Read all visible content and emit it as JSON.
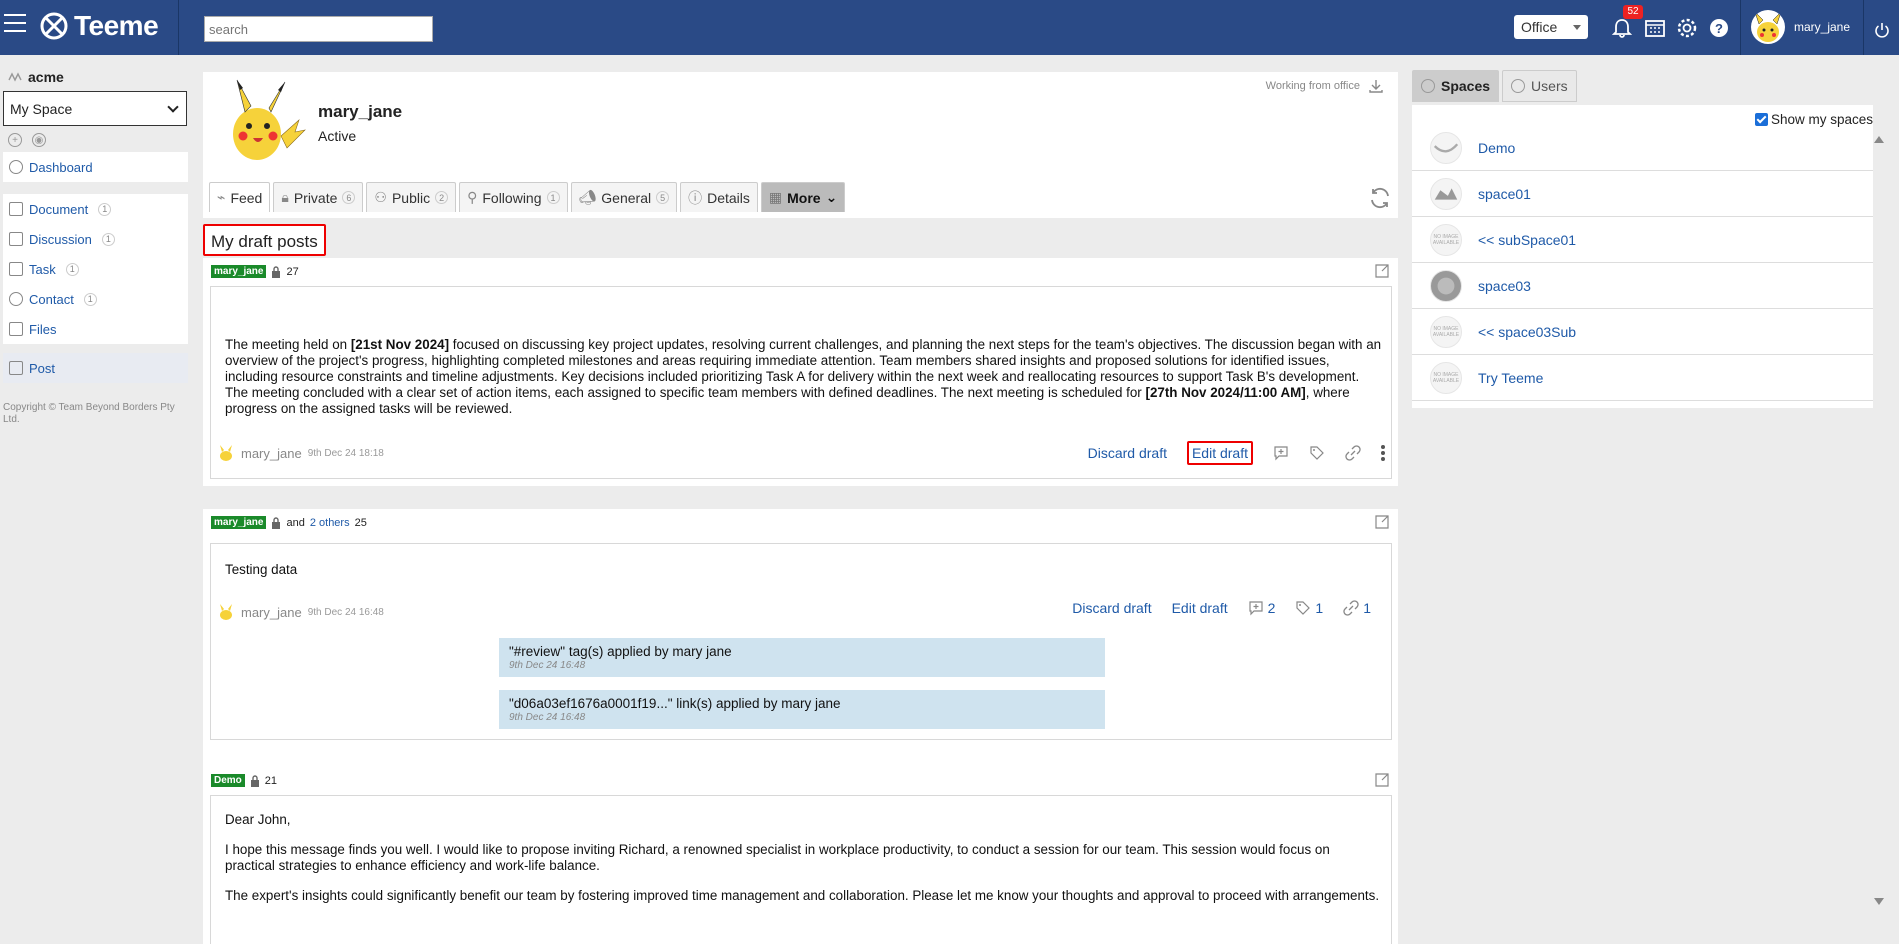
{
  "header": {
    "logo_text": "Teeme",
    "search_placeholder": "search",
    "workspace_label": "Office",
    "notification_count": "52",
    "user_name": "mary_jane"
  },
  "sidebar": {
    "org": "acme",
    "space_select": "My Space",
    "dashboard": "Dashboard",
    "items": [
      {
        "label": "Document",
        "count": "1"
      },
      {
        "label": "Discussion",
        "count": "1"
      },
      {
        "label": "Task",
        "count": "1"
      },
      {
        "label": "Contact",
        "count": "1"
      },
      {
        "label": "Files"
      }
    ],
    "post": "Post",
    "copyright": "Copyright © Team Beyond Borders Pty Ltd."
  },
  "profile": {
    "name": "mary_jane",
    "status": "Active",
    "working_status": "Working from office",
    "tabs": [
      {
        "label": "Feed"
      },
      {
        "label": "Private",
        "count": "6"
      },
      {
        "label": "Public",
        "count": "2"
      },
      {
        "label": "Following",
        "count": "1"
      },
      {
        "label": "General",
        "count": "5"
      },
      {
        "label": "Details"
      },
      {
        "label": "More"
      }
    ]
  },
  "section_title": "My draft posts",
  "posts": [
    {
      "tag": "mary_jane",
      "count": "27",
      "text_parts": [
        "The meeting held on ",
        "[21st Nov 2024]",
        " focused on discussing key project updates, resolving current challenges, and planning the next steps for the team's objectives. The discussion began with an overview of the project's progress, highlighting completed milestones and areas requiring immediate attention. Team members shared insights and proposed solutions for identified issues, including resource constraints and timeline adjustments. Key decisions included prioritizing Task A for delivery within the next week and reallocating resources to support Task B's development. The meeting concluded with a clear set of action items, each assigned to specific team members with defined deadlines. The next meeting is scheduled for ",
        "[27th Nov 2024/11:00 AM]",
        ", where progress on the assigned tasks will be reviewed."
      ],
      "author": "mary_jane",
      "date": "9th Dec 24 18:18",
      "discard": "Discard draft",
      "edit": "Edit draft"
    },
    {
      "tag": "mary_jane",
      "and_text": "and",
      "others": "2 others",
      "count": "25",
      "text": "Testing data",
      "author": "mary_jane",
      "date": "9th Dec 24 16:48",
      "discard": "Discard draft",
      "edit": "Edit draft",
      "comments": "2",
      "tags": "1",
      "links": "1",
      "activity": [
        {
          "text": "\"#review\" tag(s) applied by mary jane",
          "date": "9th Dec 24 16:48"
        },
        {
          "text": "\"d06a03ef1676a0001f19...\" link(s) applied by mary jane",
          "date": "9th Dec 24 16:48"
        }
      ]
    },
    {
      "tag": "Demo",
      "count": "21",
      "paragraphs": [
        "Dear John,",
        "I hope this message finds you well. I would like to propose inviting Richard, a renowned specialist in workplace productivity, to conduct a session for our team. This session would focus on practical strategies to enhance efficiency and work-life balance.",
        "The expert's insights could significantly benefit our team by fostering improved time management and collaboration. Please let me know your thoughts and approval to proceed with arrangements."
      ]
    }
  ],
  "right": {
    "tab_spaces": "Spaces",
    "tab_users": "Users",
    "show_my_spaces": "Show my spaces",
    "no_image": "NO IMAGE AVAILABLE",
    "spaces": [
      "Demo",
      "space01",
      "<< subSpace01",
      "space03",
      "<< space03Sub",
      "Try Teeme"
    ]
  },
  "colors": {
    "topbar": "#2a4a86",
    "link": "#1f5aa8",
    "tag_green": "#1a8a2a",
    "highlight_red": "#e00000",
    "activity_bg": "#cfe3ef"
  }
}
